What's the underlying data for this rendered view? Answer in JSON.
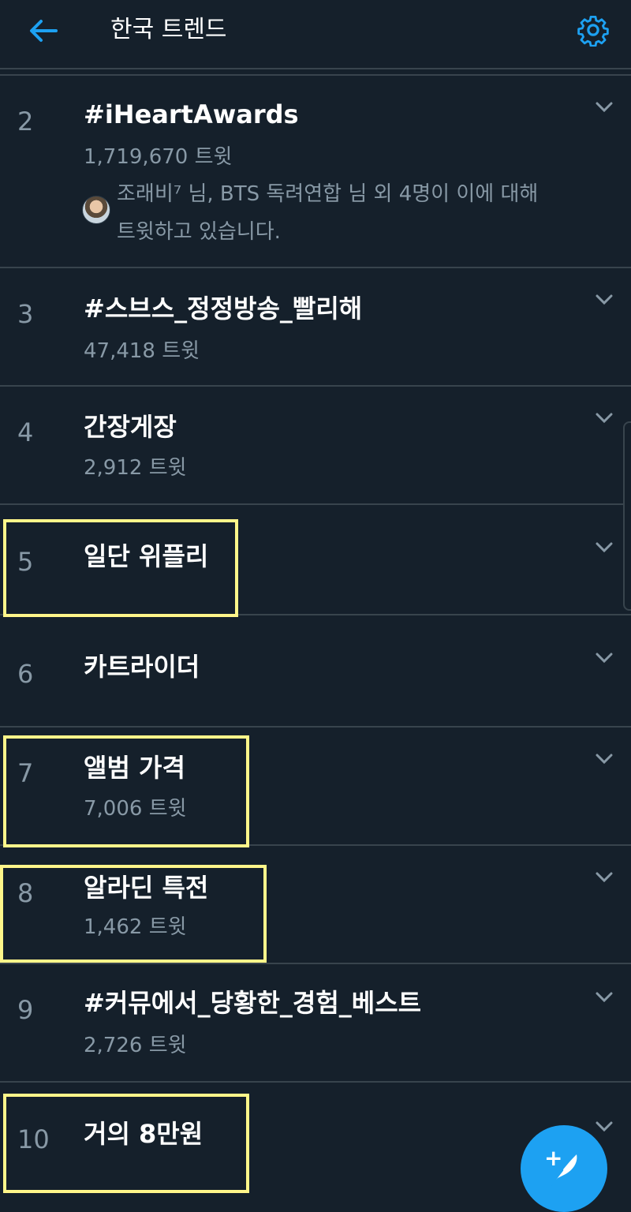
{
  "header": {
    "title": "한국 트렌드",
    "back_icon": "arrow-left-icon",
    "settings_icon": "gear-icon",
    "accent_color": "#1da1f2"
  },
  "trends": [
    {
      "rank": "2",
      "name": "#iHeartAwards",
      "tweets": "1,719,670 트윗",
      "context_line1": "조래비⁷ 님, BTS 독려연합 님 외 4명이 이에 대해",
      "context_line2": "트윗하고 있습니다."
    },
    {
      "rank": "3",
      "name": "#스브스_정정방송_빨리해",
      "tweets": "47,418 트윗"
    },
    {
      "rank": "4",
      "name": "간장게장",
      "tweets": "2,912 트윗"
    },
    {
      "rank": "5",
      "name": "일단 위플리",
      "tweets": ""
    },
    {
      "rank": "6",
      "name": "카트라이더",
      "tweets": ""
    },
    {
      "rank": "7",
      "name": "앨범 가격",
      "tweets": "7,006 트윗"
    },
    {
      "rank": "8",
      "name": "알라딘 특전",
      "tweets": "1,462 트윗"
    },
    {
      "rank": "9",
      "name": "#커뮤에서_당황한_경험_베스트",
      "tweets": "2,726 트윗"
    },
    {
      "rank": "10",
      "name": "거의 8만원",
      "tweets": ""
    }
  ],
  "highlight_color": "#fff68a",
  "fab": {
    "icon": "compose-tweet-icon",
    "plus": "+"
  }
}
